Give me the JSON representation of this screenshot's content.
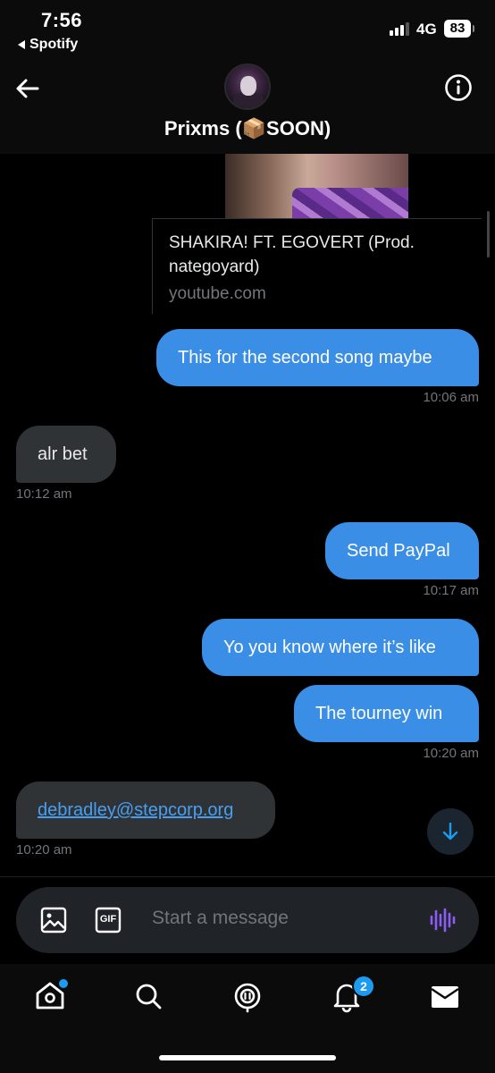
{
  "status_bar": {
    "time": "7:56",
    "back_app": "Spotify",
    "network": "4G",
    "battery": "83"
  },
  "header": {
    "contact_name": "Prixms (📦SOON)",
    "back_icon": "arrow-left-icon",
    "info_icon": "info-icon"
  },
  "link_preview": {
    "title": "SHAKIRA! FT. EGOVERT (Prod. nategoyard)",
    "domain": "youtube.com"
  },
  "messages": [
    {
      "side": "sent",
      "text": "This for the second song maybe",
      "time": "10:06 am"
    },
    {
      "side": "received",
      "text": "alr bet",
      "time": "10:12 am"
    },
    {
      "side": "sent",
      "text": "Send PayPal",
      "time": "10:17 am"
    },
    {
      "side": "sent",
      "text": "Yo you know where it’s like",
      "time": ""
    },
    {
      "side": "sent",
      "text": "The tourney win",
      "time": "10:20 am"
    },
    {
      "side": "received",
      "text": "debradley@stepcorp.org",
      "time": "10:20 am"
    }
  ],
  "composer": {
    "placeholder": "Start a message",
    "image_icon": "image-icon",
    "gif_label": "GIF",
    "voice_icon": "voice-waveform-icon"
  },
  "bottom_nav": {
    "items": [
      "home-icon",
      "search-icon",
      "spaces-icon",
      "notifications-icon",
      "messages-icon"
    ],
    "notifications_badge": "2"
  },
  "colors": {
    "sent_bubble": "#3a8ee6",
    "received_bubble": "#2f3336",
    "accent": "#1d9bf0",
    "voice_icon": "#8b5cf6"
  }
}
